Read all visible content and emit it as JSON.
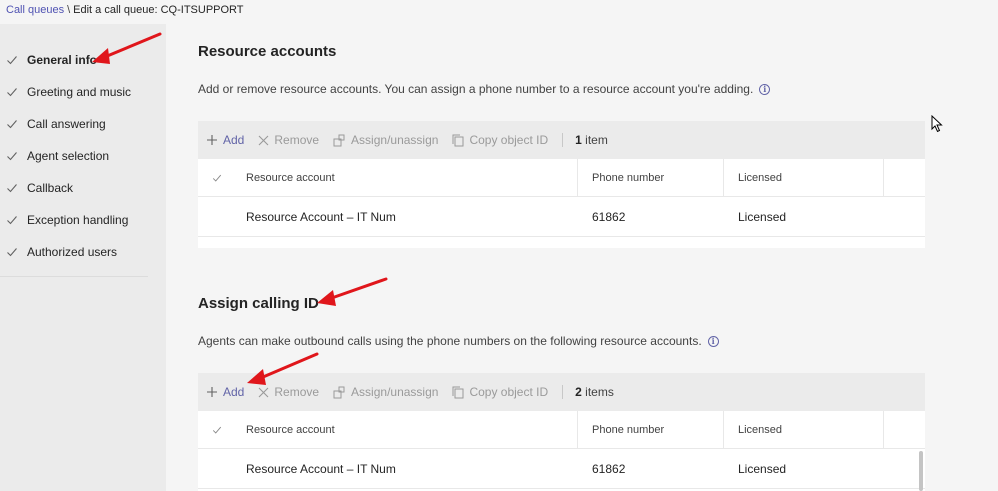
{
  "breadcrumb": {
    "link": "Call queues",
    "separator": "\\",
    "current": "Edit a call queue: CQ-ITSUPPORT"
  },
  "sidebar": {
    "items": [
      {
        "label": "General info",
        "active": true
      },
      {
        "label": "Greeting and music",
        "active": false
      },
      {
        "label": "Call answering",
        "active": false
      },
      {
        "label": "Agent selection",
        "active": false
      },
      {
        "label": "Callback",
        "active": false
      },
      {
        "label": "Exception handling",
        "active": false
      },
      {
        "label": "Authorized users",
        "active": false
      }
    ]
  },
  "resource_accounts": {
    "title": "Resource accounts",
    "description": "Add or remove resource accounts. You can assign a phone number to a resource account you're adding.",
    "toolbar": {
      "add": "Add",
      "remove": "Remove",
      "assign": "Assign/unassign",
      "copy": "Copy object ID",
      "count_num": "1",
      "count_word": "item"
    },
    "columns": [
      "Resource account",
      "Phone number",
      "Licensed"
    ],
    "rows": [
      {
        "account": "Resource Account – IT Num",
        "phone": "61862",
        "licensed": "Licensed"
      }
    ]
  },
  "calling_id": {
    "title": "Assign calling ID",
    "description": "Agents can make outbound calls using the phone numbers on the following resource accounts.",
    "toolbar": {
      "add": "Add",
      "remove": "Remove",
      "assign": "Assign/unassign",
      "copy": "Copy object ID",
      "count_num": "2",
      "count_word": "items"
    },
    "columns": [
      "Resource account",
      "Phone number",
      "Licensed"
    ],
    "rows": [
      {
        "account": "Resource Account – IT Num",
        "phone": "61862",
        "licensed": "Licensed"
      }
    ]
  },
  "colors": {
    "accent": "#6264a7",
    "annotation_arrow": "#e0161b"
  }
}
